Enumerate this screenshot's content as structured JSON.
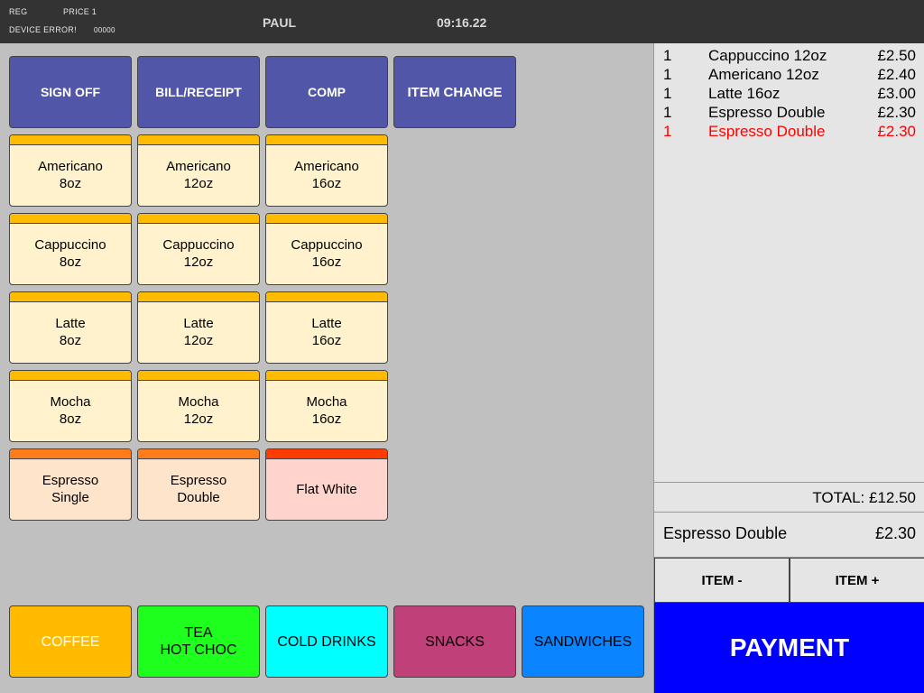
{
  "header": {
    "reg": "REG",
    "price": "PRICE 1",
    "device_error": "DEVICE ERROR!",
    "error_code": "00000",
    "user": "PAUL",
    "time": "09:16.22"
  },
  "functions": [
    "SIGN OFF",
    "BILL/RECEIPT",
    "COMP",
    "ITEM CHANGE"
  ],
  "products": [
    {
      "label": "Americano\n8oz"
    },
    {
      "label": "Americano\n12oz"
    },
    {
      "label": "Americano\n16oz"
    },
    {
      "label": "Cappuccino\n8oz"
    },
    {
      "label": "Cappuccino\n12oz"
    },
    {
      "label": "Cappuccino\n16oz"
    },
    {
      "label": "Latte\n8oz"
    },
    {
      "label": "Latte\n12oz"
    },
    {
      "label": "Latte\n16oz"
    },
    {
      "label": "Mocha\n8oz"
    },
    {
      "label": "Mocha\n12oz"
    },
    {
      "label": "Mocha\n16oz"
    },
    {
      "label": "Espresso\nSingle"
    },
    {
      "label": "Espresso\nDouble"
    },
    {
      "label": "Flat White"
    }
  ],
  "categories": [
    {
      "label": "COFFEE",
      "color": "#ffbb00"
    },
    {
      "label": "TEA\nHOT CHOC",
      "color": "#1eff1e"
    },
    {
      "label": "COLD DRINKS",
      "color": "#00ffff"
    },
    {
      "label": "SNACKS",
      "color": "#c0407a"
    },
    {
      "label": "SANDWICHES",
      "color": "#0a84ff"
    }
  ],
  "order": {
    "items": [
      {
        "qty": "1",
        "name": "Cappuccino 12oz",
        "price": "£2.50"
      },
      {
        "qty": "1",
        "name": "Americano 12oz",
        "price": "£2.40"
      },
      {
        "qty": "1",
        "name": "Latte 16oz",
        "price": "£3.00"
      },
      {
        "qty": "1",
        "name": "Espresso Double",
        "price": "£2.30"
      },
      {
        "qty": "1",
        "name": "Espresso Double",
        "price": "£2.30"
      }
    ],
    "total": "TOTAL: £12.50",
    "selected_name": "Espresso Double",
    "selected_price": "£2.30",
    "item_minus": "ITEM -",
    "item_plus": "ITEM +",
    "payment": "PAYMENT",
    "highlight_color": "#ff0000"
  },
  "colors": {
    "function_button": "#5256a8",
    "product_yellow": "#fff2cc",
    "strip_yellow": "#ffbb00",
    "product_peach": "#ffe4cc",
    "strip_orange": "#ff7c1a",
    "product_pink": "#ffd4cc",
    "strip_red": "#ff3c00",
    "payment_blue": "#0000ff"
  }
}
